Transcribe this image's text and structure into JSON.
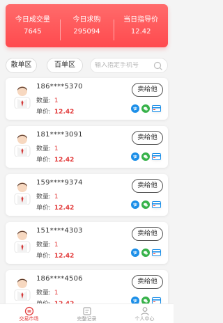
{
  "stats": [
    {
      "label": "今日成交量",
      "value": "7645"
    },
    {
      "label": "今日求购",
      "value": "295094"
    },
    {
      "label": "当日指导价",
      "value": "12.42"
    }
  ],
  "filters": {
    "scatter_label": "散单区",
    "hundred_label": "百单区",
    "search_placeholder": "输入指定手机号"
  },
  "card_labels": {
    "qty_label": "数量:",
    "price_label": "单价:",
    "sell_label": "卖给他"
  },
  "cards": [
    {
      "phone": "186****5370",
      "qty": "1",
      "price": "12.42"
    },
    {
      "phone": "181****3091",
      "qty": "1",
      "price": "12.42"
    },
    {
      "phone": "159****9374",
      "qty": "1",
      "price": "12.42"
    },
    {
      "phone": "151****4303",
      "qty": "1",
      "price": "12.42"
    },
    {
      "phone": "186****4506",
      "qty": "1",
      "price": "12.42"
    }
  ],
  "nav": [
    {
      "label": "交易市场",
      "icon": "market-icon",
      "active": true
    },
    {
      "label": "完整记录",
      "icon": "record-icon",
      "active": false
    },
    {
      "label": "个人中心",
      "icon": "user-icon",
      "active": false
    }
  ],
  "colors": {
    "accent": "#ff4a4e",
    "price": "#e23b3b",
    "alipay": "#1c8fe8",
    "wechat": "#37b24a"
  }
}
